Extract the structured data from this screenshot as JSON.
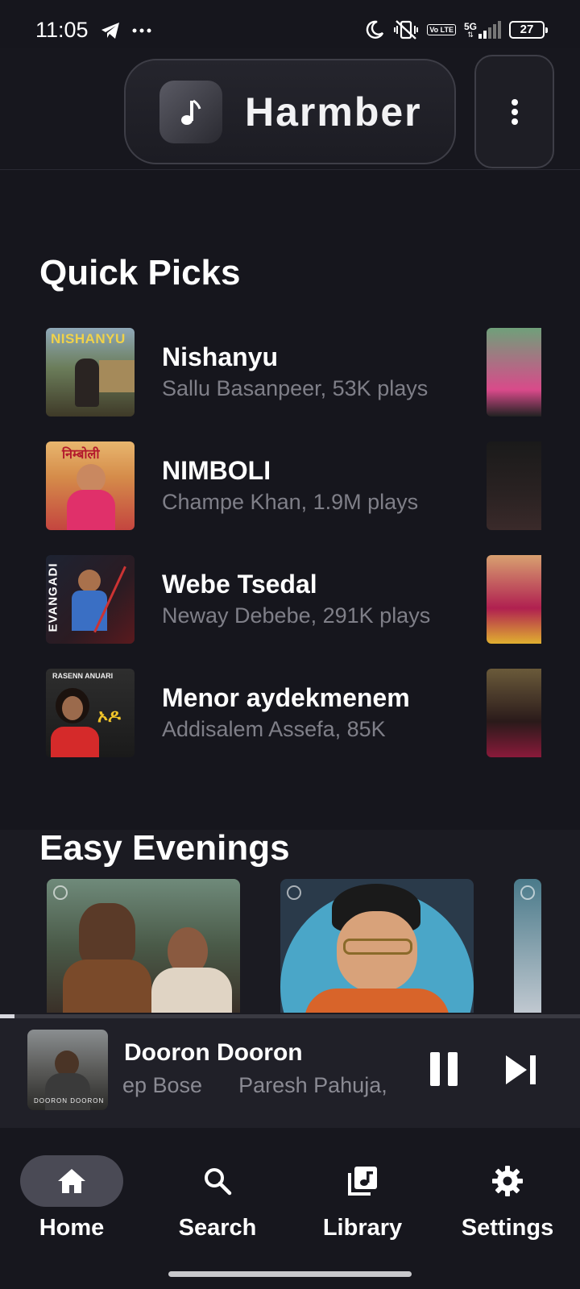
{
  "status_bar": {
    "time": "11:05",
    "left_icons": [
      "telegram-icon",
      "more-dots-icon"
    ],
    "right_icons": [
      "moon-icon",
      "vibrate-icon",
      "volte-icon",
      "signal-5g-icon",
      "battery-icon"
    ],
    "volte_label": "Vo LTE",
    "network": "5G",
    "battery": "27"
  },
  "header": {
    "app_name": "Harmber",
    "logo_icon": "music-note-icon",
    "menu_icon": "more-vertical-icon"
  },
  "quick_picks": {
    "title": "Quick Picks",
    "items": [
      {
        "song": "Nishanyu",
        "meta": "Sallu Basanpeer, 53K plays",
        "art_text": "NISHANYU"
      },
      {
        "song": "NIMBOLI",
        "meta": "Champe Khan, 1.9M plays",
        "art_text": "निम्बोली"
      },
      {
        "song": "Webe Tsedal",
        "meta": "Neway Debebe, 291K plays",
        "art_text": "EVANGADI"
      },
      {
        "song": "Menor aydekmenem",
        "meta": "Addisalem Assefa, 85K",
        "art_text": "RASENN ANUARI"
      }
    ]
  },
  "easy_evenings": {
    "title": "Easy Evenings"
  },
  "player": {
    "title": "Dooron Dooron",
    "artist": "ep Bose      Paresh Pahuja,",
    "art_text": "DOORON DOORON",
    "progress": 0.025,
    "pause_icon": "pause-icon",
    "next_icon": "skip-next-icon"
  },
  "nav": {
    "items": [
      {
        "label": "Home",
        "icon": "home-icon",
        "active": true
      },
      {
        "label": "Search",
        "icon": "search-icon",
        "active": false
      },
      {
        "label": "Library",
        "icon": "library-music-icon",
        "active": false
      },
      {
        "label": "Settings",
        "icon": "settings-gear-icon",
        "active": false
      }
    ]
  },
  "colors": {
    "background": "#16161d",
    "secondary_text": "#7f7f88",
    "active_nav": "#4a4a55"
  }
}
